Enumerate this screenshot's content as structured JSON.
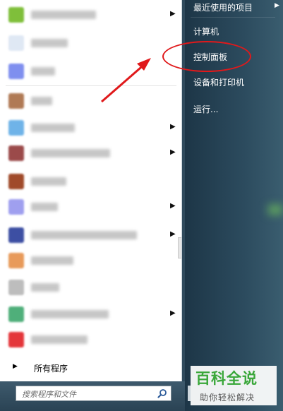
{
  "left": {
    "programs": [
      {
        "icon_color": "#7fbf3a",
        "text_w": 92,
        "arrow": true
      },
      {
        "icon_color": "#dfe8f4",
        "text_w": 52,
        "arrow": false
      },
      {
        "icon_color": "#7f8fef",
        "text_w": 34,
        "arrow": false
      },
      {
        "icon_color": "#b07a55",
        "text_w": 30,
        "arrow": false
      },
      {
        "icon_color": "#6fb3e8",
        "text_w": 62,
        "arrow": true
      },
      {
        "icon_color": "#9b4a4a",
        "text_w": 112,
        "arrow": true
      },
      {
        "icon_color": "#a04a2a",
        "text_w": 50,
        "arrow": false
      },
      {
        "icon_color": "#9f9fef",
        "text_w": 38,
        "arrow": true
      },
      {
        "icon_color": "#3d4fa3",
        "text_w": 150,
        "arrow": true
      },
      {
        "icon_color": "#e89a5a",
        "text_w": 60,
        "arrow": false
      },
      {
        "icon_color": "#bdbdbd",
        "text_w": 40,
        "arrow": false
      },
      {
        "icon_color": "#4faf7a",
        "text_w": 110,
        "arrow": true
      },
      {
        "icon_color": "#e4363a",
        "text_w": 80,
        "arrow": false
      }
    ],
    "all_programs_label": "所有程序",
    "search_placeholder": "搜索程序和文件"
  },
  "right": {
    "items": [
      {
        "label": "最近使用的项目",
        "arrow": true
      },
      {
        "label": "计算机",
        "arrow": false
      },
      {
        "label": "控制面板",
        "arrow": false
      },
      {
        "label": "设备和打印机",
        "arrow": false
      },
      {
        "label": "运行...",
        "arrow": false
      }
    ]
  },
  "watermark": {
    "main": "百科全说",
    "sub": "助你轻松解决"
  },
  "colors": {
    "annotation_red": "#e0191b",
    "watermark_green": "#3aa73a"
  }
}
